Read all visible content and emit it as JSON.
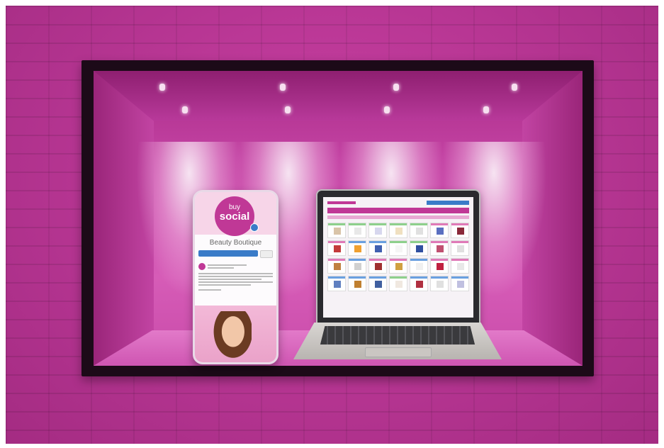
{
  "scene": "Window display with phone and laptop",
  "phone": {
    "logo_line1": "buy",
    "logo_line2": "social",
    "page_title": "Beauty Boutique",
    "colors": {
      "brand": "#c03896",
      "facebook_blue": "#3a7bc8"
    }
  },
  "laptop": {
    "product_tiles": 28
  }
}
